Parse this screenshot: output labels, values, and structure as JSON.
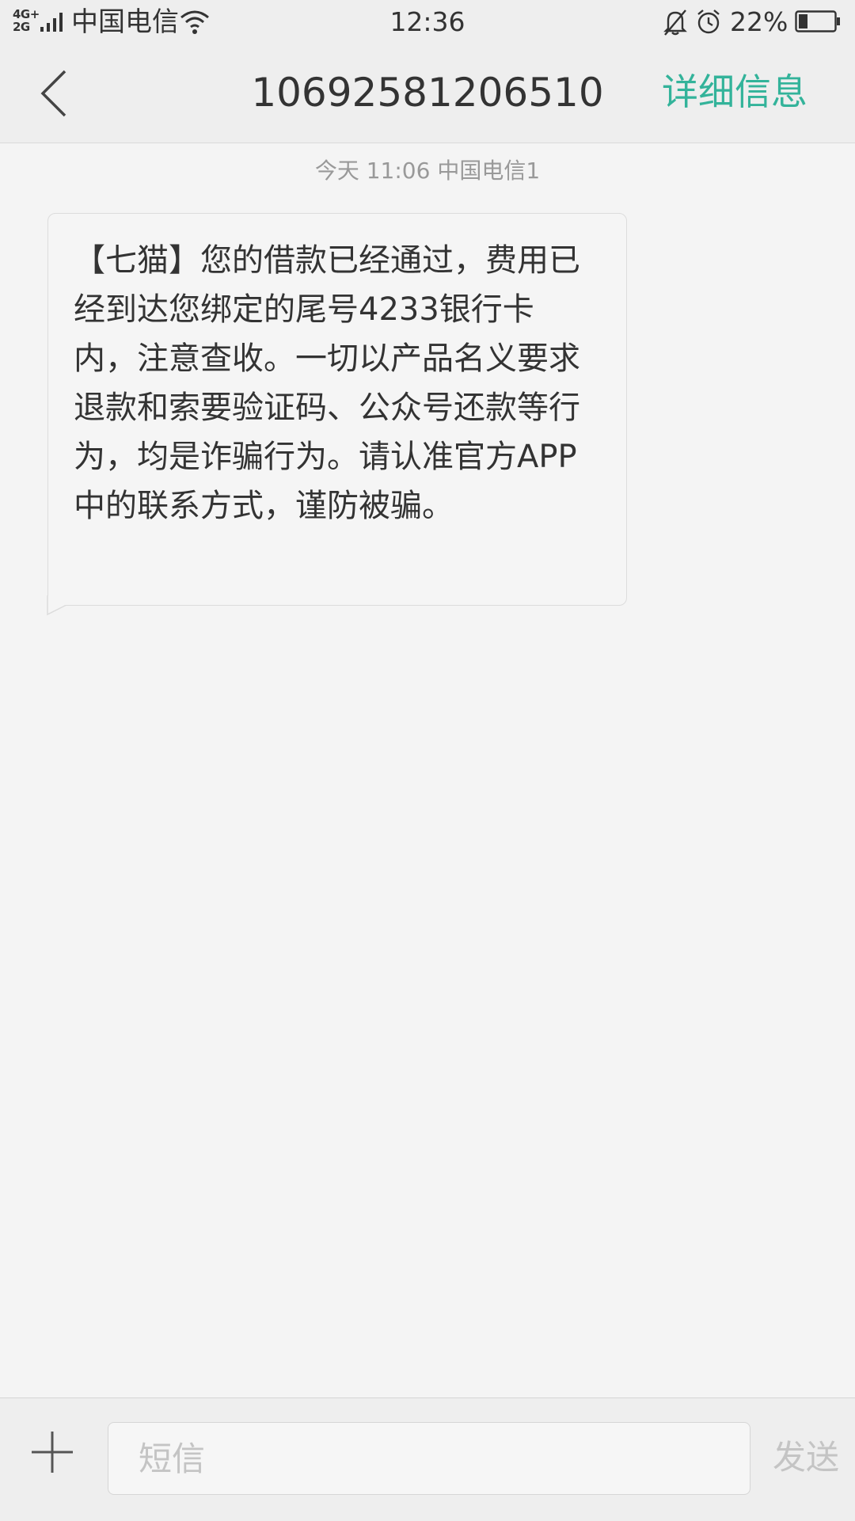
{
  "status_bar": {
    "network_type_top": "4G+",
    "network_type_bottom": "2G",
    "carrier": "中国电信",
    "time": "12:36",
    "battery_percent": "22%",
    "icons": [
      "signal-icon",
      "wifi-icon",
      "notification-off-icon",
      "alarm-icon",
      "battery-icon"
    ]
  },
  "header": {
    "back_icon": "chevron-left-icon",
    "title": "10692581206510",
    "detail_link": "详细信息",
    "accent_color": "#33b39a"
  },
  "conversation": {
    "timestamp": "今天  11:06  中国电信1",
    "messages": [
      {
        "direction": "incoming",
        "text": "【七猫】您的借款已经通过，费用已经到达您绑定的尾号4233银行卡内，注意查收。一切以产品名义要求退款和索要验证码、公众号还款等行为，均是诈骗行为。请认准官方APP中的联系方式，谨防被骗。"
      }
    ]
  },
  "composer": {
    "add_icon": "plus-icon",
    "input_placeholder": "短信",
    "input_value": "",
    "send_label": "发送"
  }
}
